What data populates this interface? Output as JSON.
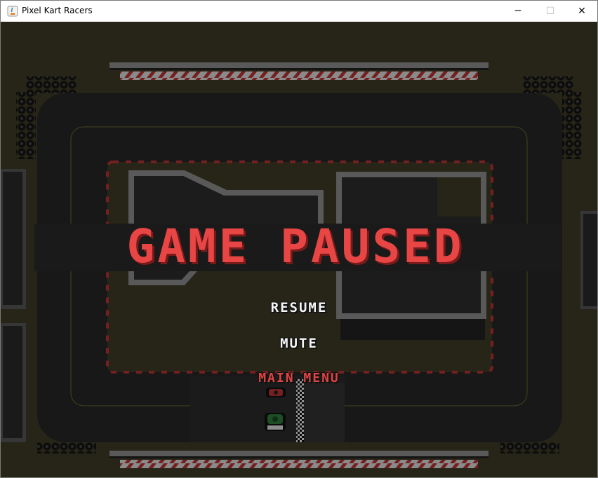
{
  "window": {
    "title": "Pixel Kart Racers",
    "controls": {
      "minimize": "─",
      "maximize": "☐",
      "close": "✕"
    }
  },
  "pause_menu": {
    "heading": "GAME PAUSED",
    "items": [
      "RESUME",
      "MUTE",
      "MAIN MENU"
    ],
    "selected_item": "MAIN MENU"
  },
  "colors": {
    "title_red": "#e84545",
    "title_shadow": "#7a1a1a",
    "grass": "#3c3a24",
    "asphalt": "#262626",
    "selected_item": "#e04444",
    "item": "#f4f4f4",
    "kart_red": "#b83232",
    "kart_green": "#2f7a3c"
  }
}
